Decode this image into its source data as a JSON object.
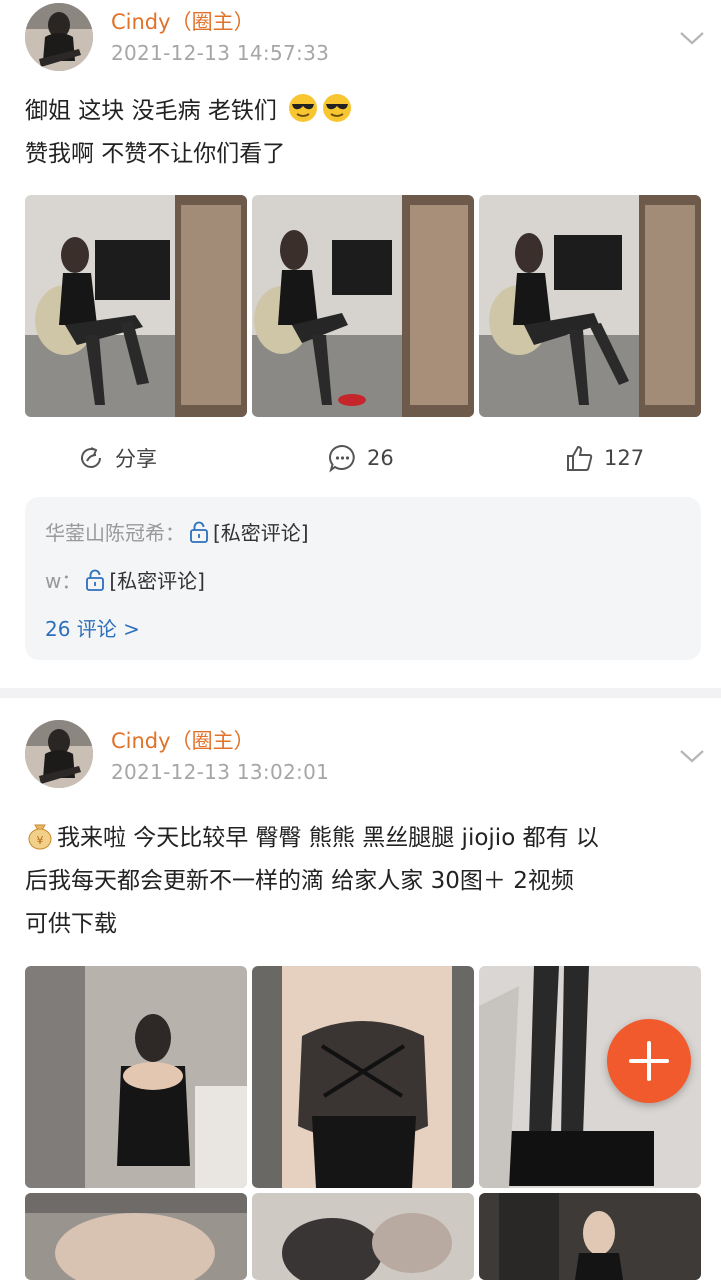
{
  "posts": [
    {
      "author": "Cindy（圈主）",
      "time": "2021-12-13 14:57:33",
      "text_line1": "御姐 这块 没毛病  老铁们",
      "text_line2": "赞我啊 不赞不让你们看了",
      "emoji_icons": [
        "sunglasses-emoji",
        "sunglasses-emoji"
      ],
      "actions": {
        "share": "分享",
        "comments": "26",
        "likes": "127"
      },
      "comments": [
        {
          "user": "华蓥山陈冠希：",
          "text": "[私密评论]"
        },
        {
          "user": "w：",
          "text": "[私密评论]"
        }
      ],
      "more_comments": "26 评论 >"
    },
    {
      "author": "Cindy（圈主）",
      "time": "2021-12-13 13:02:01",
      "text_line1": "我来啦 今天比较早 臀臀 熊熊 黑丝腿腿 jiojio 都有 以",
      "text_line2": "后我每天都会更新不一样的滴 给家人家 30图＋ 2视频",
      "text_line3": "可供下载",
      "lead_icon": "money-bag-emoji"
    }
  ],
  "colors": {
    "author": "#e0722a",
    "link": "#2e6fba",
    "fab": "#f15a2c",
    "muted": "#a6a6a6"
  }
}
